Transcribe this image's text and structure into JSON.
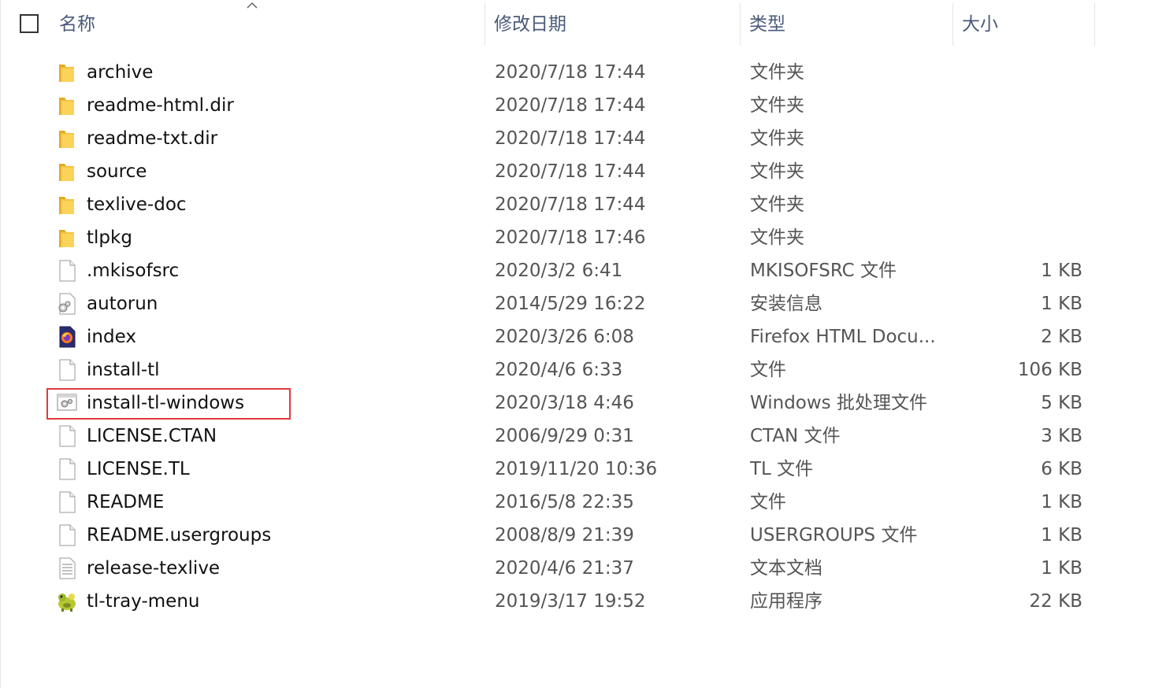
{
  "header": {
    "name_label": "名称",
    "date_label": "修改日期",
    "type_label": "类型",
    "size_label": "大小"
  },
  "files": [
    {
      "name": "archive",
      "date": "2020/7/18 17:44",
      "type": "文件夹",
      "size": "",
      "icon": "folder-icon"
    },
    {
      "name": "readme-html.dir",
      "date": "2020/7/18 17:44",
      "type": "文件夹",
      "size": "",
      "icon": "folder-icon"
    },
    {
      "name": "readme-txt.dir",
      "date": "2020/7/18 17:44",
      "type": "文件夹",
      "size": "",
      "icon": "folder-icon"
    },
    {
      "name": "source",
      "date": "2020/7/18 17:44",
      "type": "文件夹",
      "size": "",
      "icon": "folder-icon"
    },
    {
      "name": "texlive-doc",
      "date": "2020/7/18 17:44",
      "type": "文件夹",
      "size": "",
      "icon": "folder-icon"
    },
    {
      "name": "tlpkg",
      "date": "2020/7/18 17:46",
      "type": "文件夹",
      "size": "",
      "icon": "folder-icon"
    },
    {
      "name": ".mkisofsrc",
      "date": "2020/3/2 6:41",
      "type": "MKISOFSRC 文件",
      "size": "1 KB",
      "icon": "blank-file-icon"
    },
    {
      "name": "autorun",
      "date": "2014/5/29 16:22",
      "type": "安装信息",
      "size": "1 KB",
      "icon": "setup-info-icon"
    },
    {
      "name": "index",
      "date": "2020/3/26 6:08",
      "type": "Firefox HTML Docu...",
      "size": "2 KB",
      "icon": "firefox-html-icon"
    },
    {
      "name": "install-tl",
      "date": "2020/4/6 6:33",
      "type": "文件",
      "size": "106 KB",
      "icon": "blank-file-icon"
    },
    {
      "name": "install-tl-windows",
      "date": "2020/3/18 4:46",
      "type": "Windows 批处理文件",
      "size": "5 KB",
      "icon": "batch-file-icon"
    },
    {
      "name": "LICENSE.CTAN",
      "date": "2006/9/29 0:31",
      "type": "CTAN 文件",
      "size": "3 KB",
      "icon": "blank-file-icon"
    },
    {
      "name": "LICENSE.TL",
      "date": "2019/11/20 10:36",
      "type": "TL 文件",
      "size": "6 KB",
      "icon": "blank-file-icon"
    },
    {
      "name": "README",
      "date": "2016/5/8 22:35",
      "type": "文件",
      "size": "1 KB",
      "icon": "blank-file-icon"
    },
    {
      "name": "README.usergroups",
      "date": "2008/8/9 21:39",
      "type": "USERGROUPS 文件",
      "size": "1 KB",
      "icon": "blank-file-icon"
    },
    {
      "name": "release-texlive",
      "date": "2020/4/6 21:37",
      "type": "文本文档",
      "size": "1 KB",
      "icon": "text-document-icon"
    },
    {
      "name": "tl-tray-menu",
      "date": "2019/3/17 19:52",
      "type": "应用程序",
      "size": "22 KB",
      "icon": "tray-app-icon"
    }
  ],
  "highlighted_file": "install-tl-windows",
  "colors": {
    "header_text": "#4a5a7a",
    "highlight_border": "#e0393e",
    "folder": "#f5c242"
  }
}
